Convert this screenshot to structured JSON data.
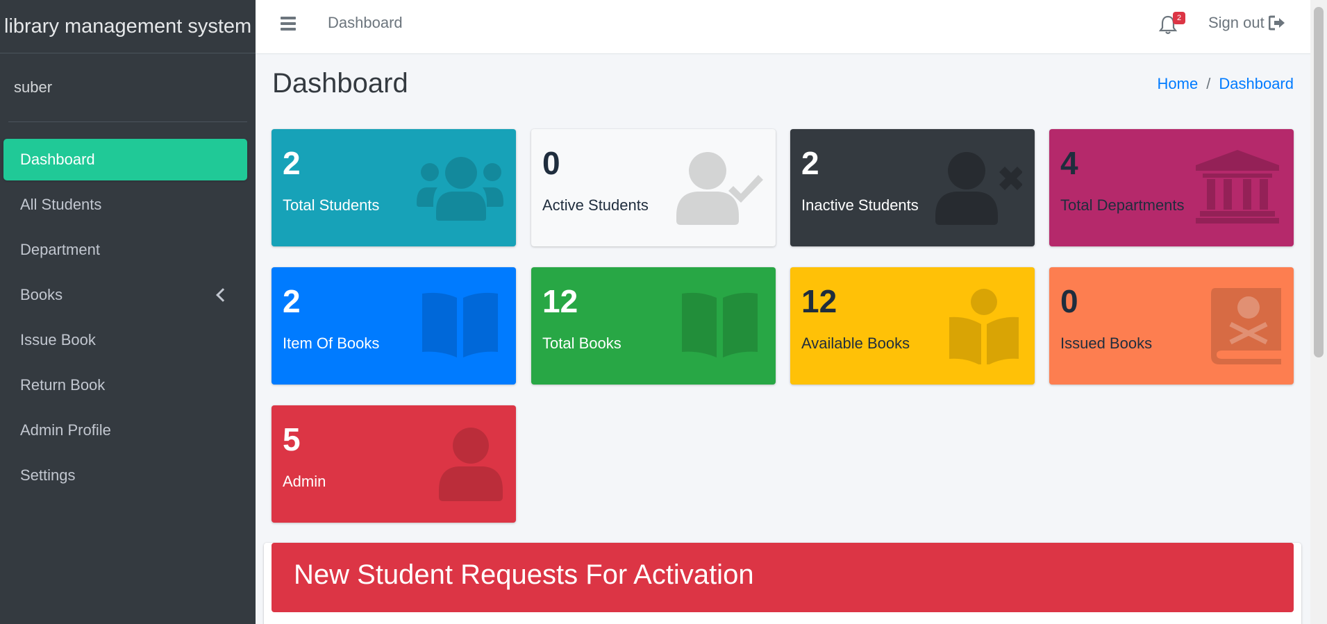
{
  "brand": "library management system",
  "user": "suber",
  "sidebar": {
    "items": [
      {
        "label": "Dashboard",
        "active": true
      },
      {
        "label": "All Students"
      },
      {
        "label": "Department"
      },
      {
        "label": "Books",
        "has_submenu": true
      },
      {
        "label": "Issue Book"
      },
      {
        "label": "Return Book"
      },
      {
        "label": "Admin Profile"
      },
      {
        "label": "Settings"
      }
    ]
  },
  "topbar": {
    "title": "Dashboard",
    "notification_count": "2",
    "signout_label": "Sign out"
  },
  "page": {
    "title": "Dashboard",
    "breadcrumb": [
      "Home",
      "Dashboard"
    ]
  },
  "stats": [
    {
      "value": "2",
      "label": "Total Students",
      "color": "#17a2b8",
      "icon": "users-icon"
    },
    {
      "value": "0",
      "label": "Active Students",
      "color": "#f8f9fa",
      "icon": "user-check-icon"
    },
    {
      "value": "2",
      "label": "Inactive Students",
      "color": "#343a40",
      "icon": "user-times-icon"
    },
    {
      "value": "4",
      "label": "Total Departments",
      "color": "#b5296b",
      "icon": "university-icon"
    },
    {
      "value": "2",
      "label": "Item Of Books",
      "color": "#007bff",
      "icon": "book-open-icon"
    },
    {
      "value": "12",
      "label": "Total Books",
      "color": "#28a745",
      "icon": "book-open-icon"
    },
    {
      "value": "12",
      "label": "Available Books",
      "color": "#ffc107",
      "icon": "book-reader-icon"
    },
    {
      "value": "0",
      "label": "Issued Books",
      "color": "#fd7e50",
      "icon": "book-dead-icon"
    },
    {
      "value": "5",
      "label": "Admin",
      "color": "#dc3545",
      "icon": "user-icon"
    }
  ],
  "requests_card": {
    "title": "New Student Requests For Activation",
    "header_color": "#dc3545"
  }
}
